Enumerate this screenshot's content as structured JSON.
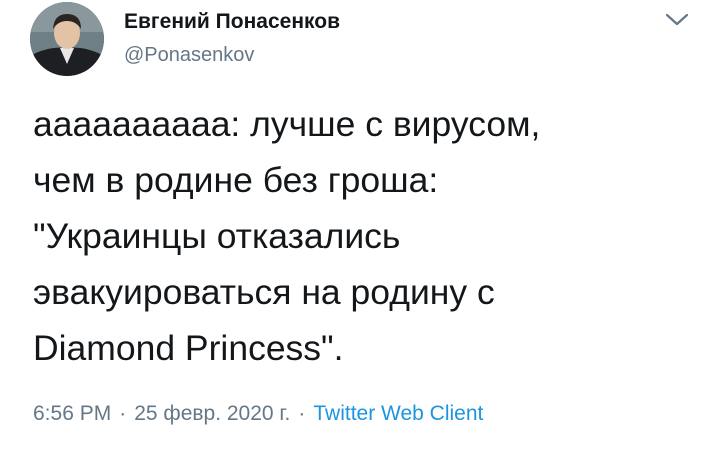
{
  "author": {
    "display_name": "Евгений Понасенков",
    "handle": "@Ponasenkov"
  },
  "icons": {
    "avatar": "profile-photo",
    "menu": "chevron-down-icon"
  },
  "tweet": {
    "text": "ааааааааaa: лучше с вирусом,\nчем в родине без гроша:\n\"Украинцы отказались\nэвакуироваться на родину с\nDiamond Princess\"."
  },
  "meta": {
    "time": "6:56 PM",
    "separator": "·",
    "date": "25 февр. 2020 г.",
    "source": "Twitter Web Client"
  },
  "colors": {
    "text": "#14171a",
    "secondary": "#657786",
    "link": "#1b95e0"
  }
}
